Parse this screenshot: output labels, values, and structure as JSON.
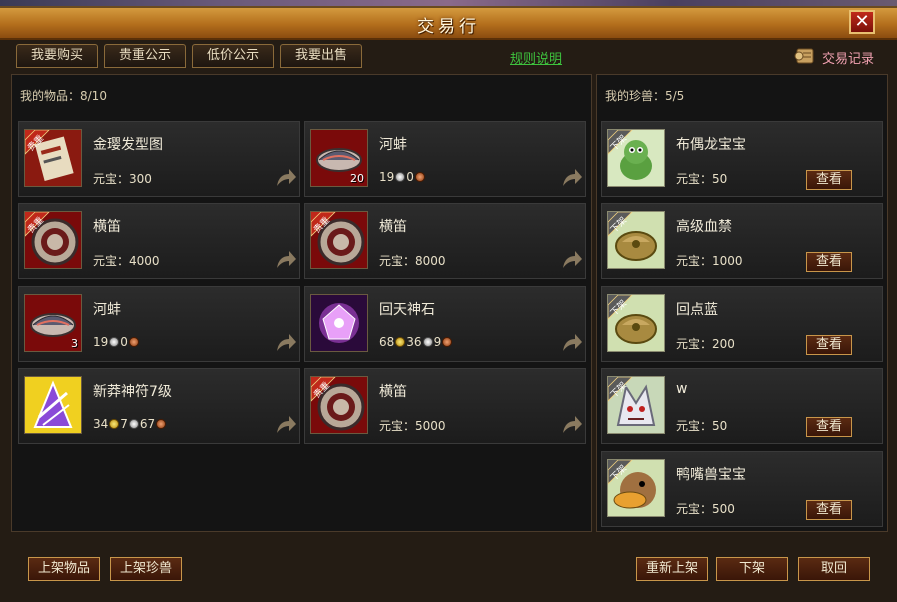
{
  "window": {
    "title": "交易行",
    "close_label": "✕"
  },
  "tabs": [
    {
      "label": "我要购买"
    },
    {
      "label": "贵重公示"
    },
    {
      "label": "低价公示"
    },
    {
      "label": "我要出售"
    }
  ],
  "rules_link": "规则说明",
  "trade_record": "交易记录",
  "my_items": {
    "header": "我的物品：8/10",
    "items": [
      {
        "name": "金璎发型图",
        "price": "元宝：300",
        "tag": "贵重",
        "icon": "scroll-icon"
      },
      {
        "name": "河蚌",
        "price_parts": [
          "19",
          "0"
        ],
        "qty": "20",
        "icon": "clam-icon"
      },
      {
        "name": "横笛",
        "price": "元宝：4000",
        "tag": "贵重",
        "icon": "flute-icon"
      },
      {
        "name": "横笛",
        "price": "元宝：8000",
        "tag": "贵重",
        "icon": "flute-icon"
      },
      {
        "name": "河蚌",
        "price_parts": [
          "19",
          "0"
        ],
        "qty": "3",
        "icon": "clam-icon"
      },
      {
        "name": "回天神石",
        "price_parts": [
          "68",
          "36",
          "9"
        ],
        "icon": "gem-icon"
      },
      {
        "name": "新莽神符7级",
        "price_parts": [
          "34",
          "7",
          "67"
        ],
        "icon": "talisman-icon"
      },
      {
        "name": "横笛",
        "price": "元宝：5000",
        "tag": "贵重",
        "icon": "flute-icon"
      }
    ]
  },
  "my_pets": {
    "header": "我的珍兽：5/5",
    "view_label": "查看",
    "tag": "下架",
    "pets": [
      {
        "name": "布偶龙宝宝",
        "price": "元宝：50",
        "icon": "dragon-pet-icon"
      },
      {
        "name": "高级血禁",
        "price": "元宝：1000",
        "icon": "pet-egg-icon"
      },
      {
        "name": "回点蓝",
        "price": "元宝：200",
        "icon": "pet-egg-icon"
      },
      {
        "name": "w",
        "price": "元宝：50",
        "icon": "wolf-pet-icon"
      },
      {
        "name": "鸭嘴兽宝宝",
        "price": "元宝：500",
        "icon": "duck-pet-icon"
      }
    ]
  },
  "bottom": {
    "list_item": "上架物品",
    "list_pet": "上架珍兽",
    "relist": "重新上架",
    "delist": "下架",
    "cancel": "取回"
  },
  "colors": {
    "title_bar": "#b36e1c",
    "rule_link": "#3ec23e",
    "trade_record": "#f0a0b0",
    "tag_red": "#c0281a",
    "tag_gray": "#5a5a5a"
  }
}
